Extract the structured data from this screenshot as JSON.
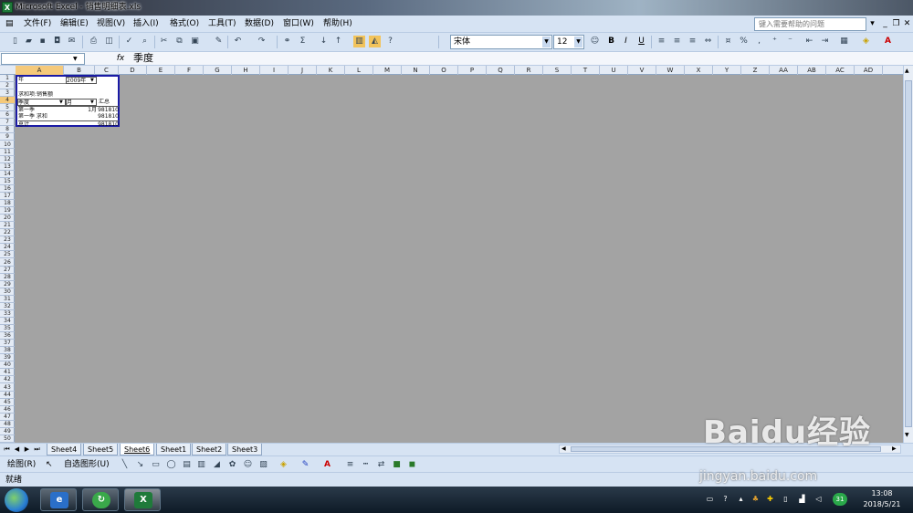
{
  "window": {
    "title": "Microsoft Excel - 销售明细表.xls",
    "app_icon": "excel-icon"
  },
  "menu": {
    "items": [
      "文件(F)",
      "编辑(E)",
      "视图(V)",
      "插入(I)",
      "格式(O)",
      "工具(T)",
      "数据(D)",
      "窗口(W)",
      "帮助(H)"
    ],
    "help_placeholder": "键入需要帮助的问题"
  },
  "toolbar": {
    "font_name": "宋体",
    "font_size": "12",
    "sum_symbol": "Σ",
    "percent": "%",
    "comma": ",",
    "bold": "B",
    "italic": "I",
    "underline": "U"
  },
  "formula_bar": {
    "name_box": "",
    "fx": "fx",
    "content": "季度"
  },
  "columns": [
    "A",
    "B",
    "C",
    "D",
    "E",
    "F",
    "G",
    "H",
    "I",
    "J",
    "K",
    "L",
    "M",
    "N",
    "O",
    "P",
    "Q",
    "R",
    "S",
    "T",
    "U",
    "V",
    "W",
    "X",
    "Y",
    "Z",
    "AA",
    "AB",
    "AC",
    "AD"
  ],
  "rows": [
    "1",
    "2",
    "3",
    "4",
    "5",
    "6",
    "7",
    "8",
    "9",
    "10",
    "11",
    "12",
    "13",
    "14",
    "15",
    "16",
    "17",
    "18",
    "19",
    "20",
    "21",
    "22",
    "23",
    "24",
    "25",
    "26",
    "27",
    "28",
    "29",
    "30",
    "31",
    "32",
    "33",
    "34",
    "35",
    "36",
    "37",
    "38",
    "39",
    "40",
    "41",
    "42",
    "43",
    "44",
    "45",
    "46",
    "47",
    "48",
    "49",
    "50"
  ],
  "pivot": {
    "a1": "年",
    "b1": "2009年",
    "a3": "求和项:销售额",
    "a4": "季度",
    "b4": "月",
    "c4": "汇总",
    "a5": "第一季",
    "b5": "1月",
    "c5": "981810",
    "a6": "第一季 求和",
    "c6": "981810",
    "a7": "总计",
    "c7": "981810"
  },
  "sheets": {
    "tabs": [
      "Sheet4",
      "Sheet5",
      "Sheet6",
      "Sheet1",
      "Sheet2",
      "Sheet3"
    ],
    "active": "Sheet6"
  },
  "drawing_toolbar": {
    "draw_label": "绘图(R)",
    "autoshapes_label": "自选图形(U)"
  },
  "status": {
    "text": "就绪"
  },
  "taskbar": {
    "time": "13:08",
    "date": "2018/5/21",
    "badge": "31"
  },
  "watermark": {
    "logo": "Baidu经验",
    "url": "jingyan.baidu.com"
  },
  "colors": {
    "ribbon": "#d6e3f3",
    "grid_gray": "#a3a3a3",
    "pivot_border": "#1a1aa6",
    "excel_green": "#1f7a3a"
  }
}
